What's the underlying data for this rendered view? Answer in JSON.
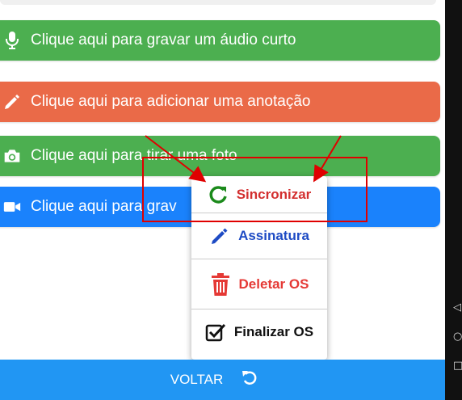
{
  "actions": {
    "audio_label": "Clique aqui para gravar um áudio curto",
    "note_label": "Clique aqui para adicionar uma anotação",
    "photo_label": "Clique aqui para tirar uma foto",
    "video_label": "Clique aqui para grav"
  },
  "menu": {
    "sync_label": "Sincronizar",
    "sign_label": "Assinatura",
    "delete_label": "Deletar OS",
    "finish_label": "Finalizar OS"
  },
  "footer": {
    "back_label": "VOLTAR"
  },
  "colors": {
    "green": "#4caf50",
    "orange": "#ea6a48",
    "blue": "#1a82fc",
    "footer_blue": "#2196f3",
    "sync_red": "#d32f2f",
    "sign_blue": "#1e4bc4",
    "annotation_red": "#e00000"
  },
  "icons": {
    "audio": "microphone-icon",
    "note": "pencil-icon",
    "photo": "camera-icon",
    "video": "video-camera-icon",
    "sync": "refresh-icon",
    "sign": "pencil-icon",
    "delete": "trash-icon",
    "finish": "checkbox-icon",
    "back": "undo-icon"
  }
}
